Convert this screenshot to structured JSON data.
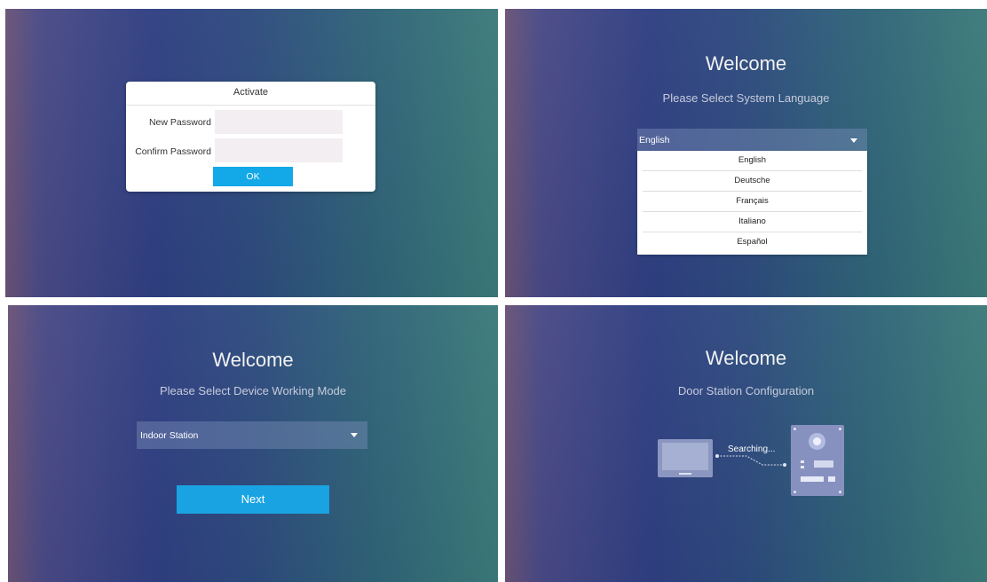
{
  "activate": {
    "title": "Activate",
    "new_password_label": "New Password",
    "confirm_password_label": "Confirm Password",
    "ok_label": "OK"
  },
  "language": {
    "welcome": "Welcome",
    "subtitle": "Please Select System Language",
    "selected": "English",
    "options": [
      "English",
      "Deutsche",
      "Français",
      "Italiano",
      "Español"
    ]
  },
  "mode": {
    "welcome": "Welcome",
    "subtitle": "Please Select Device Working Mode",
    "selected": "Indoor Station",
    "next_label": "Next"
  },
  "door": {
    "welcome": "Welcome",
    "subtitle": "Door Station Configuration",
    "searching": "Searching..."
  },
  "colors": {
    "accent": "#13a8e8"
  }
}
